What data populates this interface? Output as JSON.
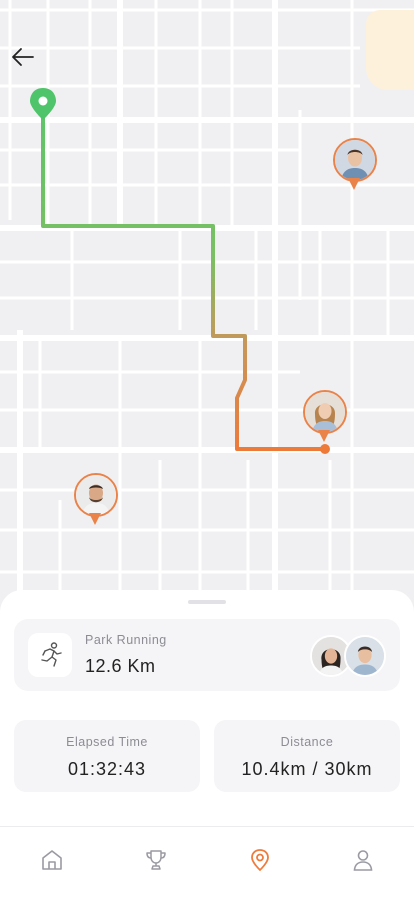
{
  "map": {
    "back_icon": "arrow-left-icon",
    "route_colors": {
      "start": "#5ec46a",
      "middle": "#c8965a",
      "end": "#ee7a3a"
    },
    "pin_color": "#e9834a"
  },
  "activity": {
    "title": "Park Running",
    "value": "12.6 Km",
    "icon": "running-person-icon"
  },
  "stats": [
    {
      "label": "Elapsed Time",
      "value": "01:32:43"
    },
    {
      "label": "Distance",
      "value": "10.4km / 30km"
    }
  ],
  "tabs": [
    {
      "name": "home",
      "icon": "home-icon",
      "active": false
    },
    {
      "name": "trophy",
      "icon": "trophy-icon",
      "active": false
    },
    {
      "name": "location",
      "icon": "location-pin-icon",
      "active": true
    },
    {
      "name": "profile",
      "icon": "user-icon",
      "active": false
    }
  ],
  "colors": {
    "accent": "#ef7b3c",
    "inactive": "#9a9aa2"
  }
}
